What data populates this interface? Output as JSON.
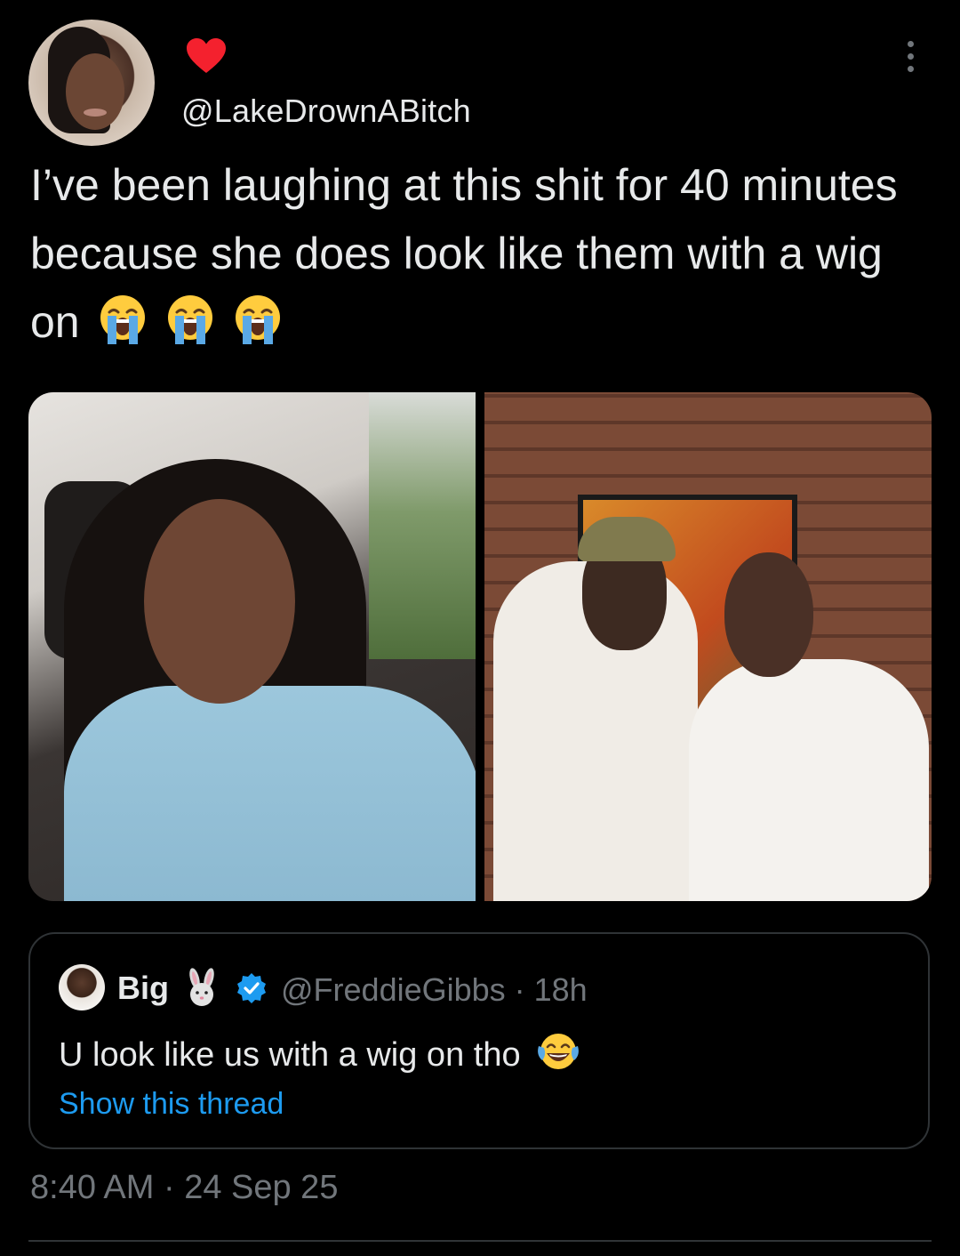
{
  "tweet": {
    "handle": "@LakeDrownABitch",
    "text": "I’ve been laughing at this shit for 40 minutes because she does look like them with a wig on",
    "emoji_count": 3,
    "emoji_name": "loudly-crying-face-emoji",
    "timestamp": "8:40 AM · 24 Sep 25"
  },
  "quoted_tweet": {
    "name": "Big",
    "handle_and_time": "@FreddieGibbs · 18h",
    "text": "U look like us with a wig on tho",
    "emoji_name": "face-with-tears-of-joy-emoji",
    "show_thread_label": "Show this thread",
    "verified": true
  },
  "colors": {
    "background": "#000000",
    "text_primary": "#e7e9ea",
    "text_secondary": "#71767b",
    "link": "#1d9bf0",
    "heart": "#f4212e",
    "border": "#2f3336"
  },
  "icons": [
    "heart-icon",
    "more-options-icon",
    "rabbit-icon",
    "verified-badge-icon"
  ]
}
